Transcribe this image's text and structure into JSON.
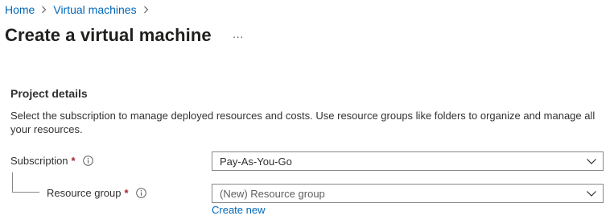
{
  "breadcrumb": {
    "items": [
      {
        "label": "Home"
      },
      {
        "label": "Virtual machines"
      }
    ]
  },
  "header": {
    "title": "Create a virtual machine",
    "more_label": "···"
  },
  "project_details": {
    "title": "Project details",
    "description": "Select the subscription to manage deployed resources and costs. Use resource groups like folders to organize and manage all your resources."
  },
  "subscription": {
    "label": "Subscription",
    "required_mark": "*",
    "value": "Pay-As-You-Go"
  },
  "resource_group": {
    "label": "Resource group",
    "required_mark": "*",
    "placeholder": "(New) Resource group",
    "create_new_label": "Create new"
  },
  "colors": {
    "link": "#0067b8",
    "required": "#a4262c",
    "border": "#8a8886",
    "text": "#323130"
  },
  "icons": {
    "breadcrumb_separator": "chevron-right-icon",
    "info": "info-icon",
    "dropdown": "chevron-down-icon"
  }
}
